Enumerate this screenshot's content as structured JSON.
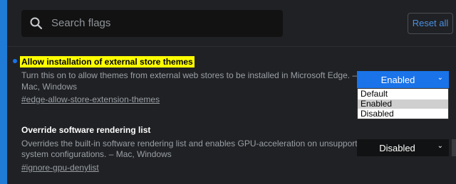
{
  "search": {
    "placeholder": "Search flags",
    "icon": "search-icon"
  },
  "header": {
    "reset_label": "Reset all"
  },
  "flags": [
    {
      "title": "Allow installation of external store themes",
      "description_line1": "Turn this on to allow themes from external web stores to be installed in Microsoft Edge. –",
      "description_line2": "Mac, Windows",
      "tag": "#edge-allow-store-extension-themes",
      "selected": "Enabled",
      "options": [
        "Default",
        "Enabled",
        "Disabled"
      ]
    },
    {
      "title": "Override software rendering list",
      "description_line1": "Overrides the built-in software rendering list and enables GPU-acceleration on unsupported",
      "description_line2": "system configurations. – Mac, Windows",
      "tag": "#ignore-gpu-denylist",
      "selected": "Disabled"
    }
  ],
  "colors": {
    "accent": "#1a73e8",
    "highlight": "#ffff00",
    "background": "#202124",
    "frame": "#1f7bd6"
  }
}
